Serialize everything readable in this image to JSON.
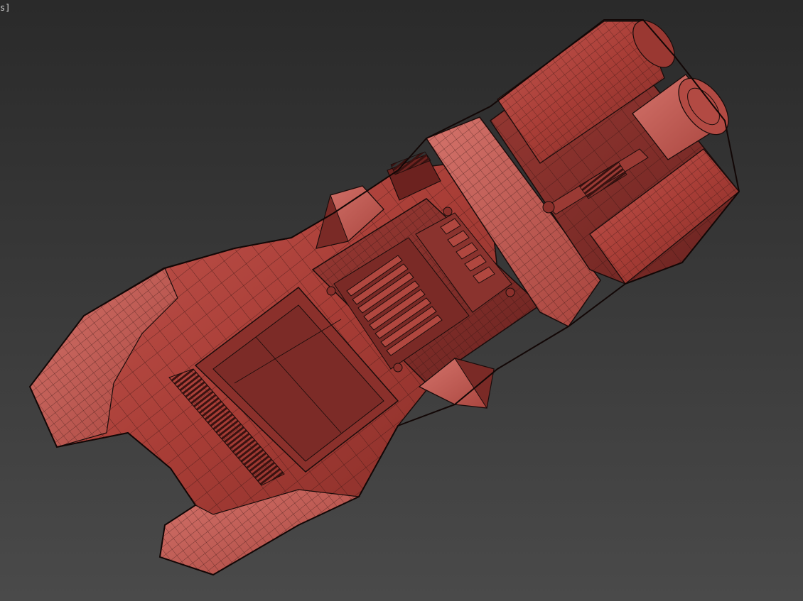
{
  "viewport": {
    "label": "s]",
    "shading": "wireframe-on-shaded",
    "model_color": "#b0413a",
    "wire_color": "#1a0c0b",
    "background_top": "#2a2a2a",
    "background_bottom": "#4a4a4a"
  }
}
